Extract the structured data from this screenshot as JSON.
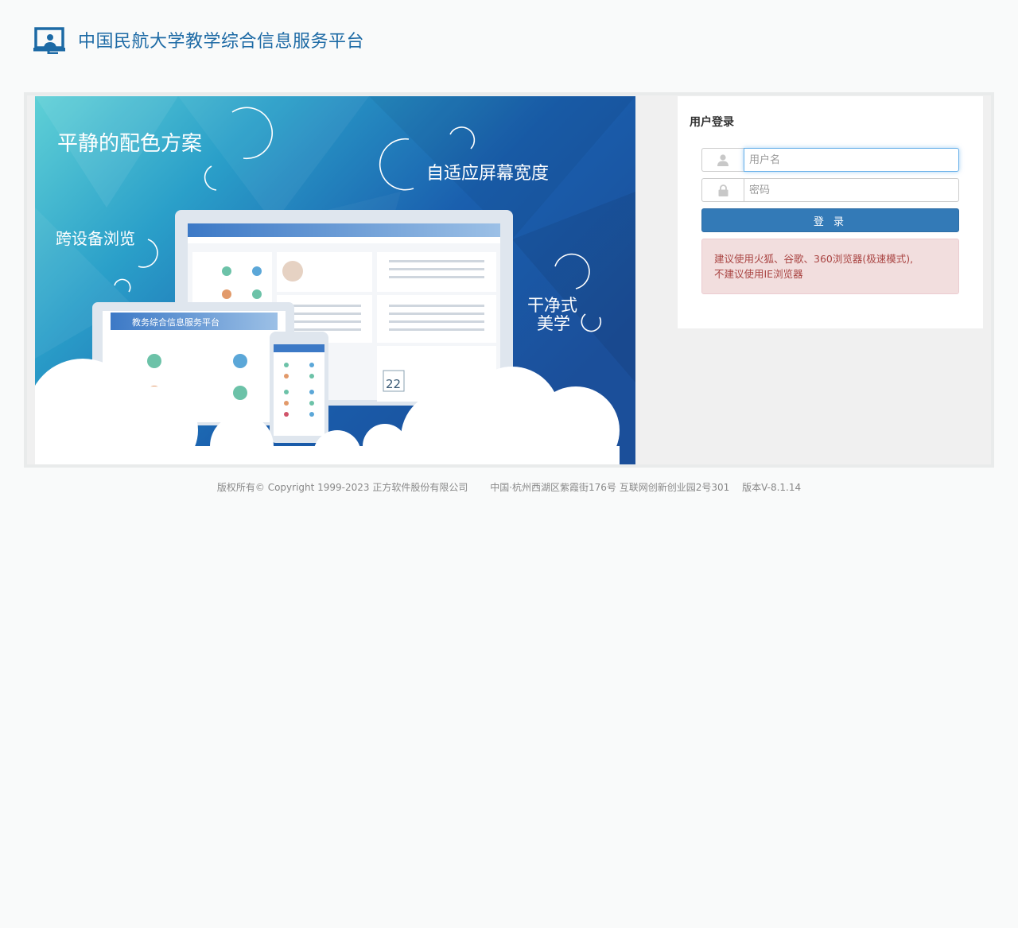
{
  "header": {
    "title": "中国民航大学教学综合信息服务平台",
    "logo_icon": "platform-logo-icon"
  },
  "banner": {
    "slogans": {
      "palette": "平静的配色方案",
      "responsive": "自适应屏幕宽度",
      "cross_device": "跨设备浏览",
      "clean_line1": "干净式",
      "clean_line2": "美学"
    },
    "mock_platform_title": "教务综合信息服务平台",
    "mock_calendar_day": "22"
  },
  "login": {
    "title": "用户登录",
    "username_placeholder": "用户名",
    "password_placeholder": "密码",
    "submit_label": "登 录",
    "browser_notice_line1": "建议使用火狐、谷歌、360浏览器(极速模式),",
    "browser_notice_line2": "不建议使用IE浏览器"
  },
  "footer": {
    "copyright": "版权所有© Copyright 1999-2023 正方软件股份有限公司",
    "address": "中国·杭州西湖区紫霞街176号 互联网创新创业园2号301",
    "version": "版本V-8.1.14"
  },
  "colors": {
    "brand": "#1d6aa5",
    "primary_button": "#337ab7",
    "alert_bg": "#f2dede",
    "alert_text": "#a94442"
  }
}
